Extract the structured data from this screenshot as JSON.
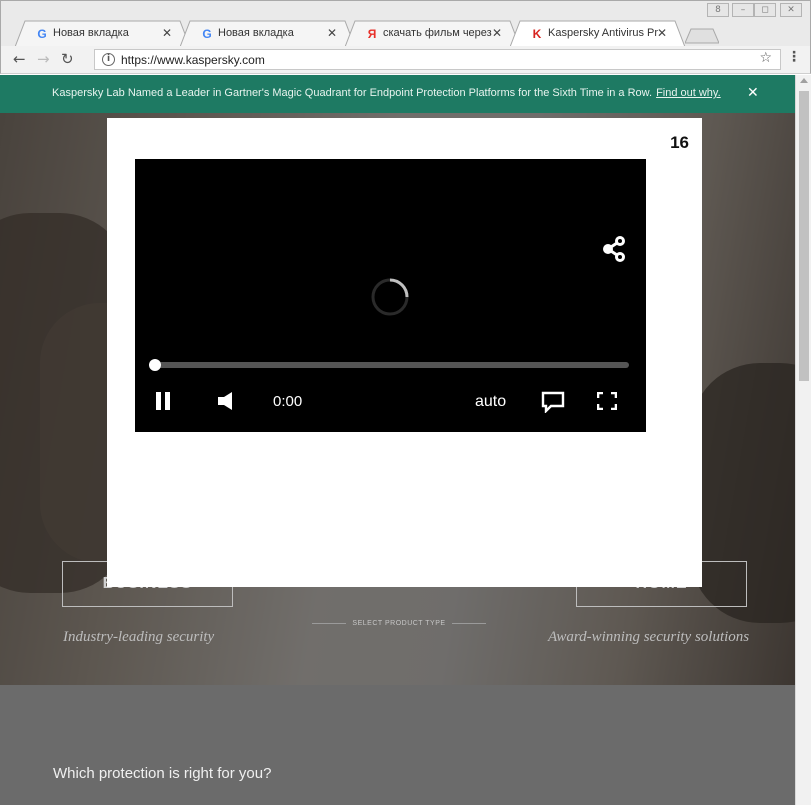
{
  "browser": {
    "tabs": [
      {
        "title": "Новая вкладка",
        "favicon": "google-g-icon",
        "favicon_glyph": "G",
        "favicon_color": "#4285f4",
        "active": false
      },
      {
        "title": "Новая вкладка",
        "favicon": "google-g-icon",
        "favicon_glyph": "G",
        "favicon_color": "#4285f4",
        "active": false
      },
      {
        "title": "скачать фильм через то",
        "favicon": "yandex-icon",
        "favicon_glyph": "Я",
        "favicon_color": "#e8312a",
        "active": false
      },
      {
        "title": "Kaspersky Antivirus Prote",
        "favicon": "kaspersky-icon",
        "favicon_glyph": "K",
        "favicon_color": "#d7241f",
        "active": true
      }
    ],
    "tab_close_glyph": "✕",
    "url": "https://www.kaspersky.com",
    "window_controls": {
      "profile": "8",
      "minimize": "–",
      "maximize": "◻",
      "close": "✕"
    }
  },
  "banner": {
    "text": "Kaspersky Lab Named a Leader in Gartner's Magic Quadrant for Endpoint Protection Platforms for the Sixth Time in a Row.",
    "link": "Find out why.",
    "close": "✕",
    "color": "#1e7a63"
  },
  "hero": {
    "left_button": "BUSINESS",
    "right_button": "HOME",
    "left_tagline": "Industry-leading security",
    "right_tagline": "Award-winning security solutions",
    "select_label": "SELECT PRODUCT TYPE"
  },
  "section": {
    "question": "Which protection is right for you?"
  },
  "modal": {
    "counter": "16",
    "player": {
      "time": "0:00",
      "quality": "auto",
      "progress": 0.0,
      "state": "loading"
    }
  }
}
